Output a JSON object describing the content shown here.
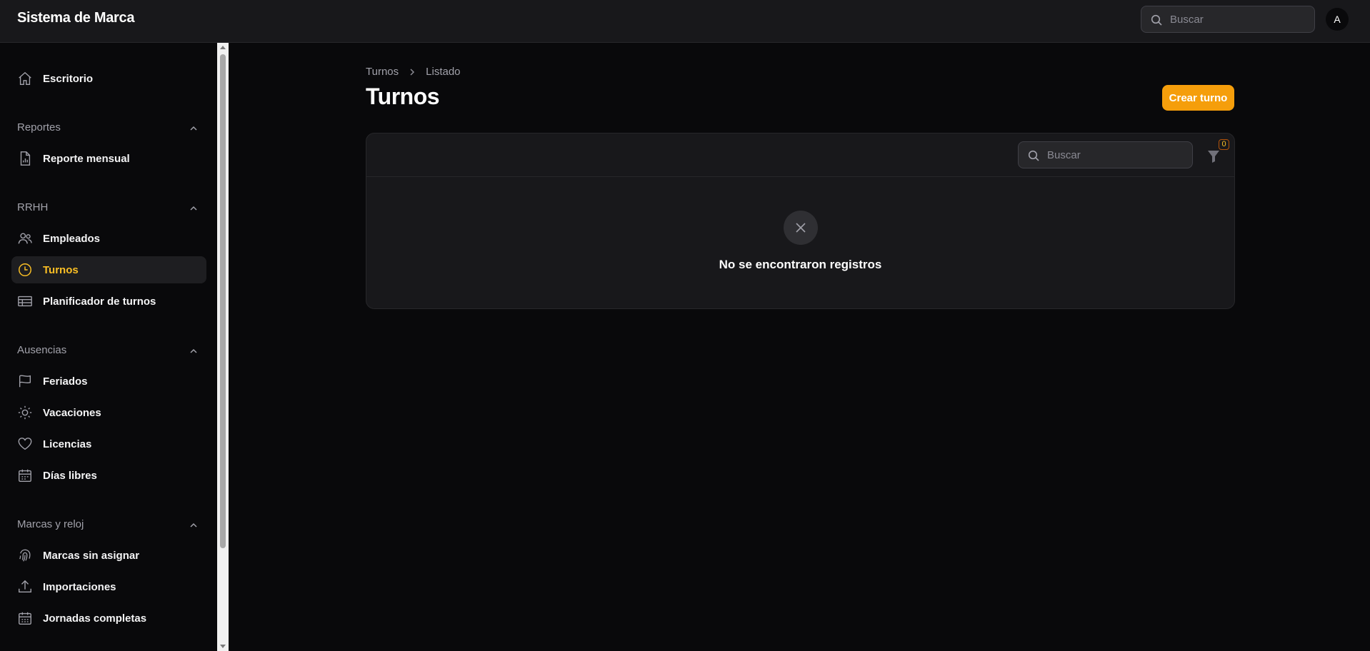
{
  "app": {
    "brand": "Sistema de Marca"
  },
  "topbar": {
    "search_placeholder": "Buscar",
    "avatar_initial": "A"
  },
  "sidebar": {
    "dashboard": "Escritorio",
    "groups": [
      {
        "label": "Reportes",
        "items": [
          {
            "label": "Reporte mensual",
            "icon": "report-file-icon"
          }
        ]
      },
      {
        "label": "RRHH",
        "items": [
          {
            "label": "Empleados",
            "icon": "users-icon"
          },
          {
            "label": "Turnos",
            "icon": "clock-icon",
            "active": true
          },
          {
            "label": "Planificador de turnos",
            "icon": "table-icon"
          }
        ]
      },
      {
        "label": "Ausencias",
        "items": [
          {
            "label": "Feriados",
            "icon": "flag-icon"
          },
          {
            "label": "Vacaciones",
            "icon": "sun-icon"
          },
          {
            "label": "Licencias",
            "icon": "heart-icon"
          },
          {
            "label": "Días libres",
            "icon": "calendar-icon"
          }
        ]
      },
      {
        "label": "Marcas y reloj",
        "items": [
          {
            "label": "Marcas sin asignar",
            "icon": "fingerprint-icon"
          },
          {
            "label": "Importaciones",
            "icon": "upload-icon"
          },
          {
            "label": "Jornadas completas",
            "icon": "calendar-days-icon"
          }
        ]
      }
    ]
  },
  "breadcrumb": {
    "parent": "Turnos",
    "current": "Listado"
  },
  "page": {
    "title": "Turnos",
    "create_label": "Crear turno"
  },
  "table": {
    "search_placeholder": "Buscar",
    "filter_count": "0",
    "empty_message": "No se encontraron registros"
  },
  "colors": {
    "accent": "#f59e0b",
    "accent_text": "#fbbf24",
    "background": "#09090b",
    "panel": "#18181b"
  }
}
